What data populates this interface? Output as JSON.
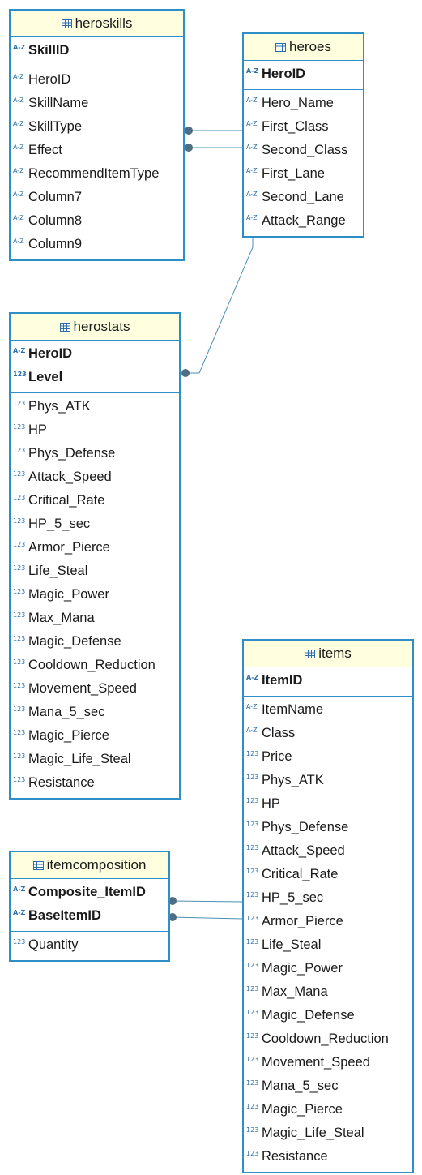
{
  "colors": {
    "border": "#2e8ec7",
    "header_bg": "#ffffe0",
    "connector": "#4a8fb4",
    "connector_dot": "#4f6d80"
  },
  "icons": {
    "string": "A-Z",
    "numeric": "123",
    "table": "table-icon"
  },
  "entities": [
    {
      "name": "heroskills",
      "keys": [
        {
          "name": "SkillID",
          "type": "string"
        }
      ],
      "columns": [
        {
          "name": "HeroID",
          "type": "string"
        },
        {
          "name": "SkillName",
          "type": "string"
        },
        {
          "name": "SkillType",
          "type": "string"
        },
        {
          "name": "Effect",
          "type": "string"
        },
        {
          "name": "RecommendItemType",
          "type": "string"
        },
        {
          "name": "Column7",
          "type": "string"
        },
        {
          "name": "Column8",
          "type": "string"
        },
        {
          "name": "Column9",
          "type": "string"
        }
      ]
    },
    {
      "name": "heroes",
      "keys": [
        {
          "name": "HeroID",
          "type": "string"
        }
      ],
      "columns": [
        {
          "name": "Hero_Name",
          "type": "string"
        },
        {
          "name": "First_Class",
          "type": "string"
        },
        {
          "name": "Second_Class",
          "type": "string"
        },
        {
          "name": "First_Lane",
          "type": "string"
        },
        {
          "name": "Second_Lane",
          "type": "string"
        },
        {
          "name": "Attack_Range",
          "type": "string"
        }
      ]
    },
    {
      "name": "herostats",
      "keys": [
        {
          "name": "HeroID",
          "type": "string"
        },
        {
          "name": "Level",
          "type": "numeric"
        }
      ],
      "columns": [
        {
          "name": "Phys_ATK",
          "type": "numeric"
        },
        {
          "name": "HP",
          "type": "numeric"
        },
        {
          "name": "Phys_Defense",
          "type": "numeric"
        },
        {
          "name": "Attack_Speed",
          "type": "numeric"
        },
        {
          "name": "Critical_Rate",
          "type": "numeric"
        },
        {
          "name": "HP_5_sec",
          "type": "numeric"
        },
        {
          "name": "Armor_Pierce",
          "type": "numeric"
        },
        {
          "name": "Life_Steal",
          "type": "numeric"
        },
        {
          "name": "Magic_Power",
          "type": "numeric"
        },
        {
          "name": "Max_Mana",
          "type": "numeric"
        },
        {
          "name": "Magic_Defense",
          "type": "numeric"
        },
        {
          "name": "Cooldown_Reduction",
          "type": "numeric"
        },
        {
          "name": "Movement_Speed",
          "type": "numeric"
        },
        {
          "name": "Mana_5_sec",
          "type": "numeric"
        },
        {
          "name": "Magic_Pierce",
          "type": "numeric"
        },
        {
          "name": "Magic_Life_Steal",
          "type": "numeric"
        },
        {
          "name": "Resistance",
          "type": "numeric"
        }
      ]
    },
    {
      "name": "items",
      "keys": [
        {
          "name": "ItemID",
          "type": "string"
        }
      ],
      "columns": [
        {
          "name": "ItemName",
          "type": "string"
        },
        {
          "name": "Class",
          "type": "string"
        },
        {
          "name": "Price",
          "type": "numeric"
        },
        {
          "name": "Phys_ATK",
          "type": "numeric"
        },
        {
          "name": "HP",
          "type": "numeric"
        },
        {
          "name": "Phys_Defense",
          "type": "numeric"
        },
        {
          "name": "Attack_Speed",
          "type": "numeric"
        },
        {
          "name": "Critical_Rate",
          "type": "numeric"
        },
        {
          "name": "HP_5_sec",
          "type": "numeric"
        },
        {
          "name": "Armor_Pierce",
          "type": "numeric"
        },
        {
          "name": "Life_Steal",
          "type": "numeric"
        },
        {
          "name": "Magic_Power",
          "type": "numeric"
        },
        {
          "name": "Max_Mana",
          "type": "numeric"
        },
        {
          "name": "Magic_Defense",
          "type": "numeric"
        },
        {
          "name": "Cooldown_Reduction",
          "type": "numeric"
        },
        {
          "name": "Movement_Speed",
          "type": "numeric"
        },
        {
          "name": "Mana_5_sec",
          "type": "numeric"
        },
        {
          "name": "Magic_Pierce",
          "type": "numeric"
        },
        {
          "name": "Magic_Life_Steal",
          "type": "numeric"
        },
        {
          "name": "Resistance",
          "type": "numeric"
        }
      ]
    },
    {
      "name": "itemcomposition",
      "keys": [
        {
          "name": "Composite_ItemID",
          "type": "string"
        },
        {
          "name": "BaseItemID",
          "type": "string"
        }
      ],
      "columns": [
        {
          "name": "Quantity",
          "type": "numeric"
        }
      ]
    }
  ]
}
